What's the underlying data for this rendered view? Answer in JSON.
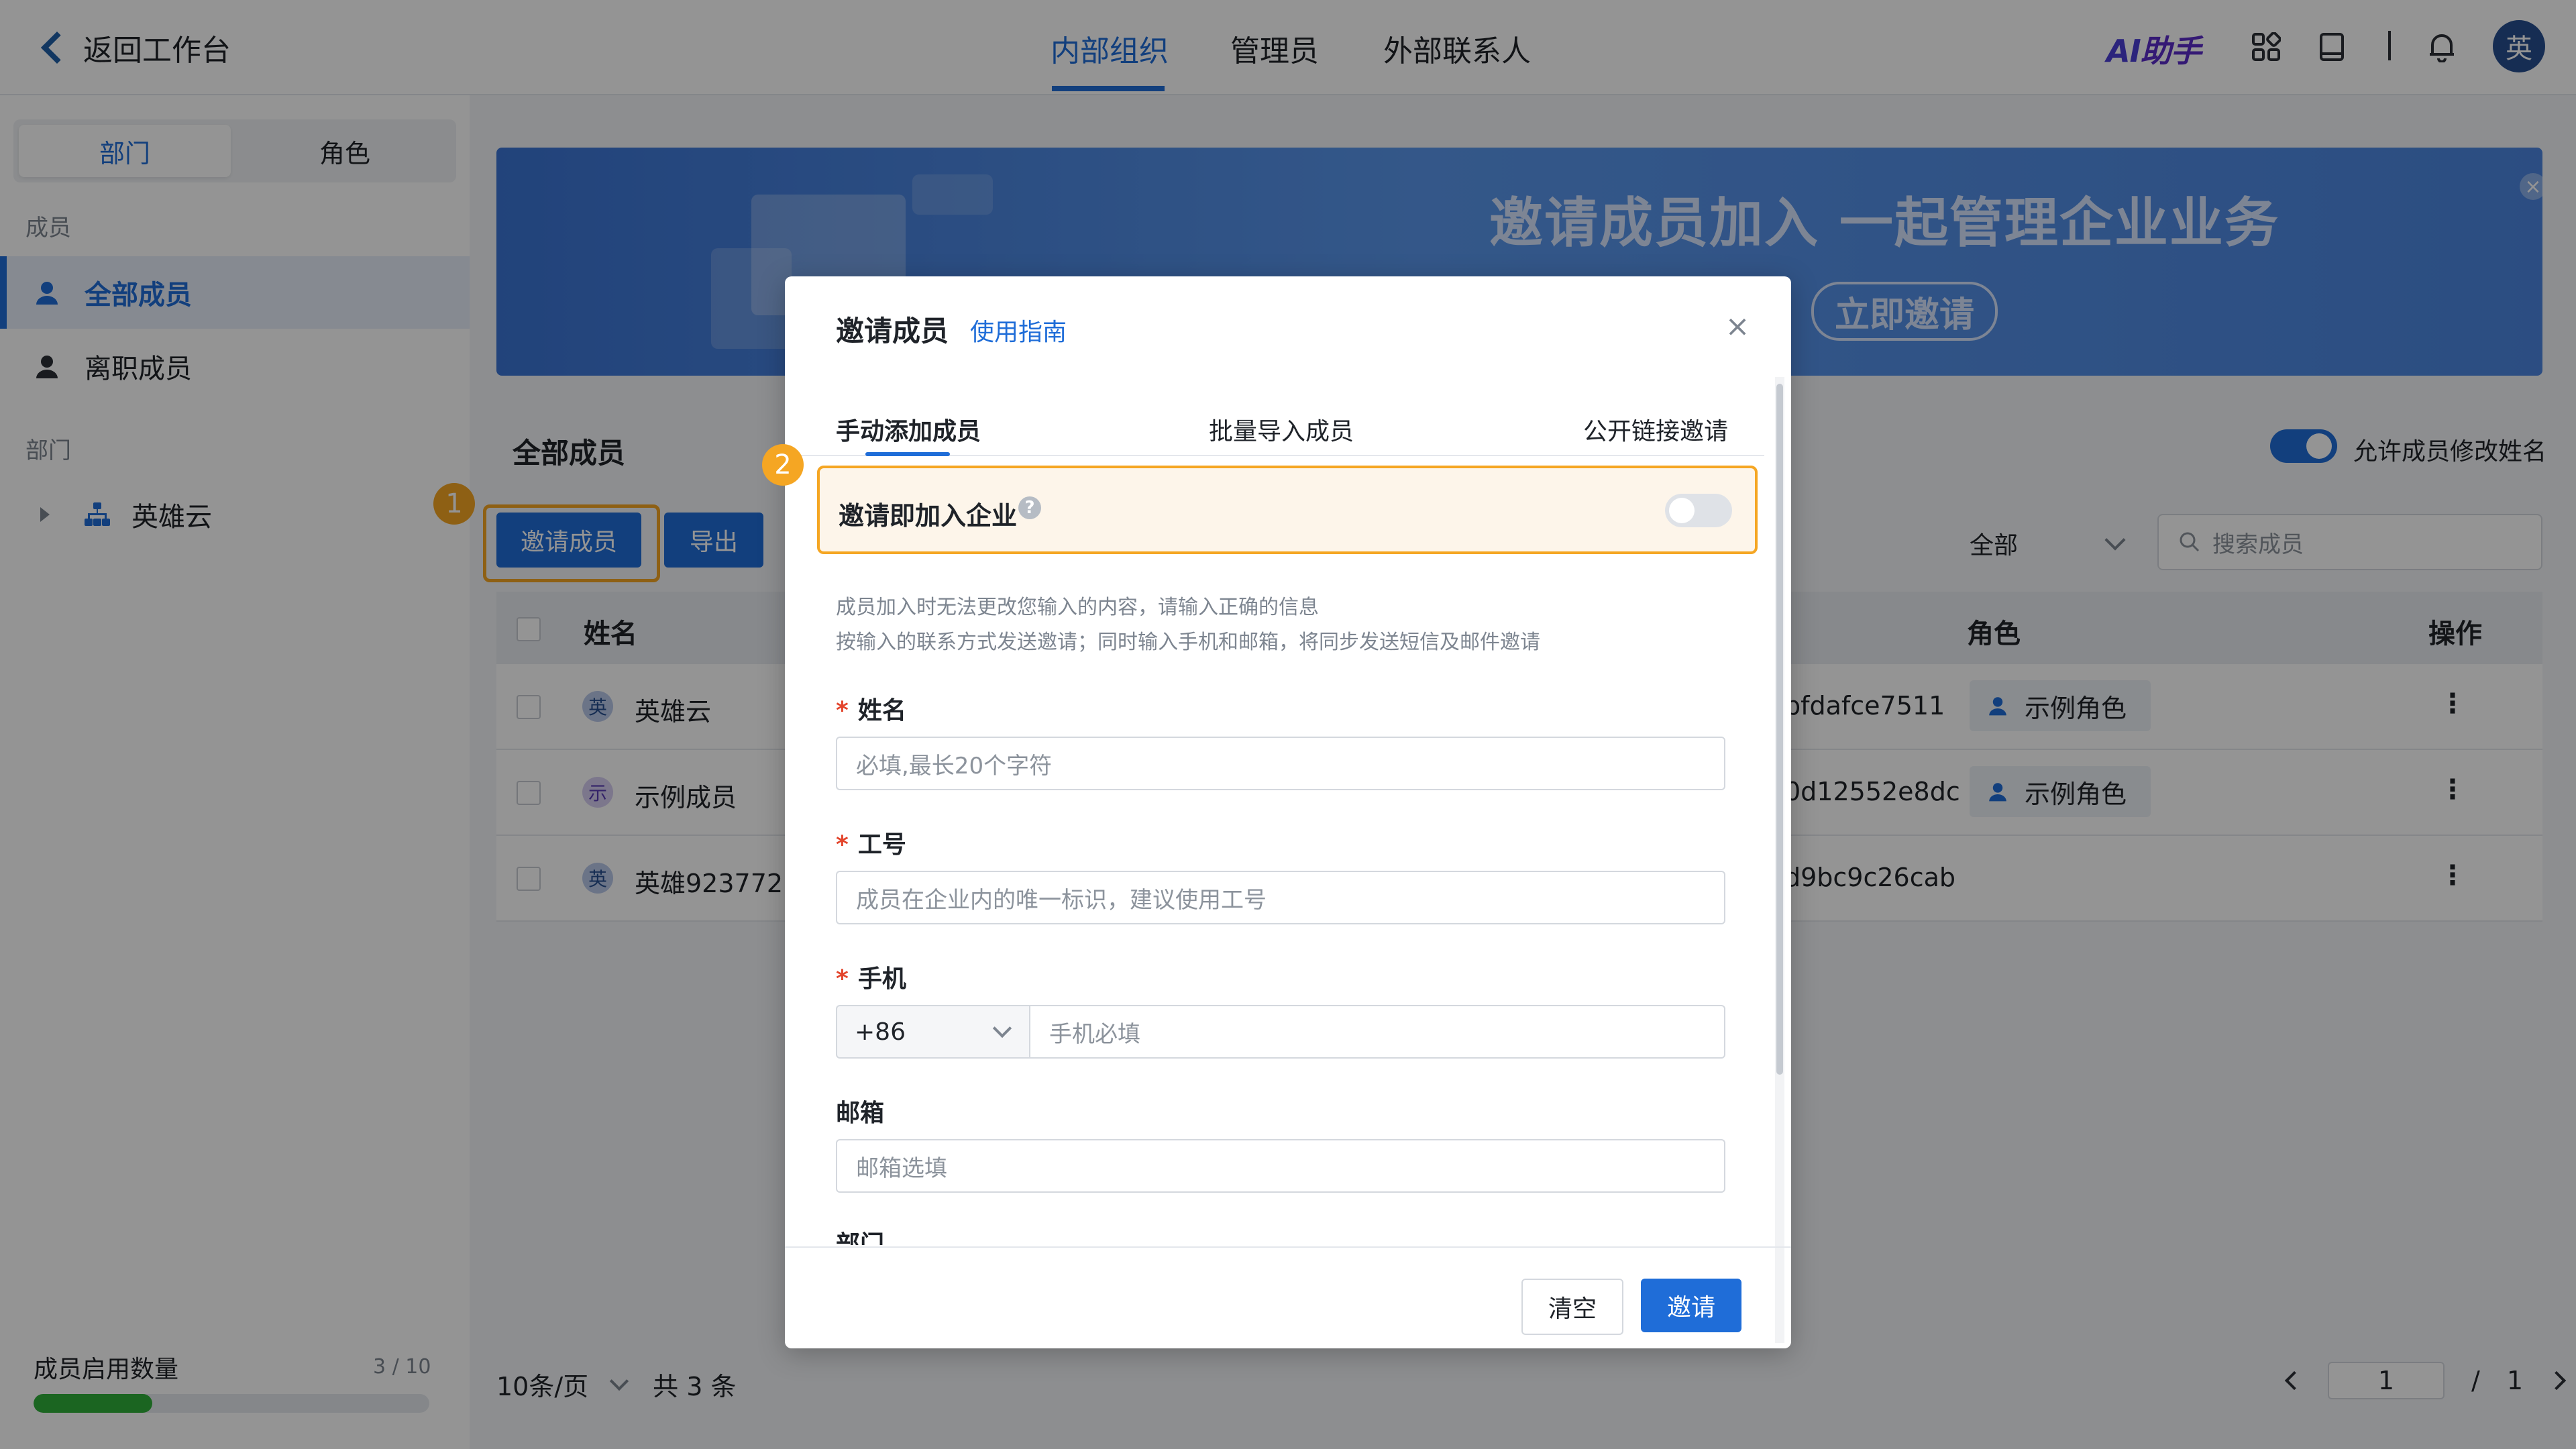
{
  "topbar": {
    "back_label": "返回工作台",
    "tabs": [
      "内部组织",
      "管理员",
      "外部联系人"
    ],
    "active_tab": "内部组织",
    "ai_label_ai": "AI",
    "ai_label_zh": "助手",
    "avatar": "英"
  },
  "sidebar": {
    "seg_tabs": [
      "部门",
      "角色"
    ],
    "members_section": "成员",
    "members_items": [
      "全部成员",
      "离职成员"
    ],
    "dept_section": "部门",
    "dept_tree": [
      "英雄云"
    ],
    "quota_label": "成员启用数量",
    "quota_value": "3 / 10",
    "quota_progress": 0.3
  },
  "banner": {
    "title": "邀请成员加入 一起管理企业业务",
    "button": "立即邀请"
  },
  "main": {
    "section_title": "全部成员",
    "invite_button": "邀请成员",
    "export_button": "导出",
    "step1": "1",
    "allow_edit_label": "允许成员修改姓名",
    "filter_value": "全部",
    "search_placeholder": "搜索成员",
    "columns": {
      "name": "姓名",
      "role": "角色",
      "actions": "操作"
    },
    "rows": [
      {
        "avatar": "英",
        "name": "英雄云",
        "id_suffix": "bfdafce7511",
        "role": "示例角色"
      },
      {
        "avatar": "示",
        "name": "示例成员",
        "id_suffix": "0d12552e8dc",
        "role": "示例角色"
      },
      {
        "avatar": "英",
        "name": "英雄923772",
        "id_suffix": "d9bc9c26cab",
        "role": ""
      }
    ],
    "more_glyph": "⋮",
    "pager": {
      "page_size": "10条/页",
      "total": "共 3 条",
      "current": "1",
      "sep": "/",
      "total_pages": "1"
    }
  },
  "modal": {
    "title": "邀请成员",
    "guide_link": "使用指南",
    "close": "×",
    "tabs": [
      "手动添加成员",
      "批量导入成员",
      "公开链接邀请"
    ],
    "active_tab": "手动添加成员",
    "step2": "2",
    "invite_join_label": "邀请即加入企业",
    "hint1": "成员加入时无法更改您输入的内容，请输入正确的信息",
    "hint2": "按输入的联系方式发送邀请；同时输入手机和邮箱，将同步发送短信及邮件邀请",
    "fields": {
      "name_label": "姓名",
      "name_placeholder": "必填,最长20个字符",
      "no_label": "工号",
      "no_placeholder": "成员在企业内的唯一标识，建议使用工号",
      "phone_label": "手机",
      "phone_prefix": "+86",
      "phone_placeholder": "手机必填",
      "email_label": "邮箱",
      "email_placeholder": "邮箱选填",
      "dept_label": "部门"
    },
    "required_mark": "*",
    "clear_button": "清空",
    "invite_button": "邀请"
  }
}
